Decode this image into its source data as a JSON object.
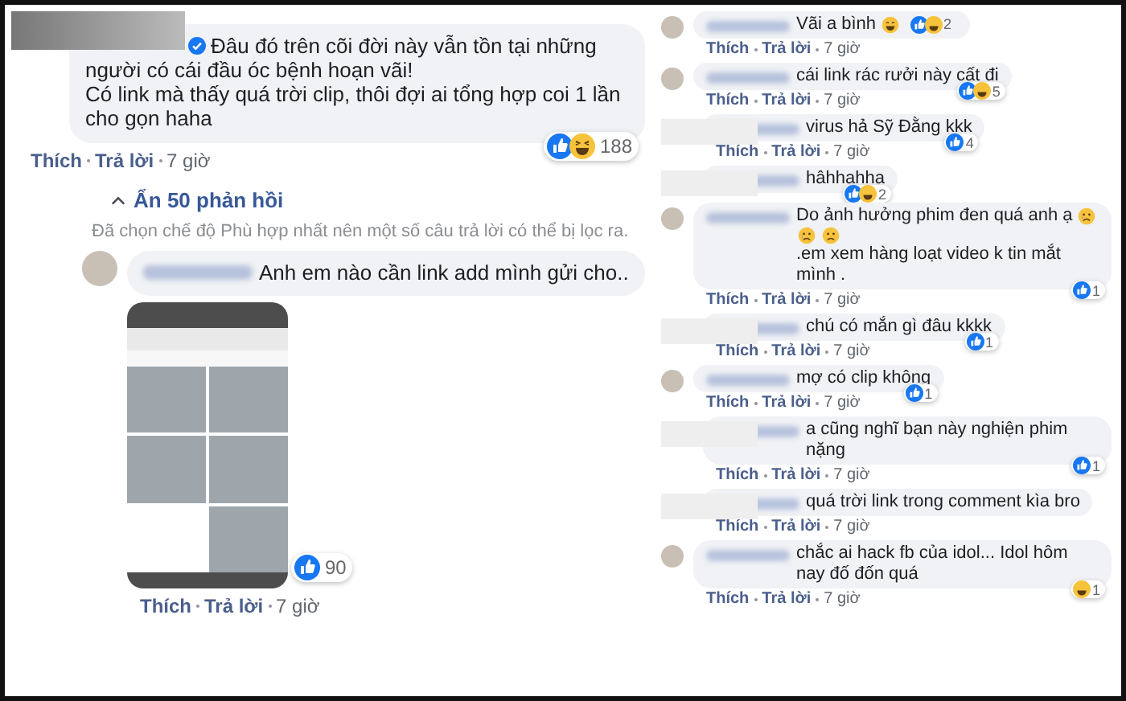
{
  "left": {
    "main_comment": {
      "verified": true,
      "text_lines": [
        "Đâu đó trên cõi đời này vẫn tồn tại những người có cái đầu óc bệnh hoạn vãi!",
        "Có link mà thấy quá trời clip, thôi đợi ai tổng hợp coi 1 lần cho gọn haha"
      ],
      "reactions": [
        {
          "kind": "like"
        },
        {
          "kind": "haha"
        }
      ],
      "reaction_count": "188",
      "actions": [
        "Thích",
        "Trả lời",
        "7 giờ"
      ]
    },
    "hide_replies": "Ẩn 50 phản hồi",
    "filter_notice": "Đã chọn chế độ Phù hợp nhất nên một số câu trả lời có thể bị lọc ra.",
    "reply": {
      "text": "Anh em nào cần link add mình gửi cho..",
      "reactions": [
        {
          "kind": "like"
        }
      ],
      "reaction_count": "90",
      "actions": [
        "Thích",
        "Trả lời",
        "7 giờ"
      ]
    }
  },
  "right": {
    "comments": [
      {
        "redacted": false,
        "segments": [
          {
            "kind": "text",
            "text": "Vãi a bình"
          },
          {
            "kind": "grin"
          }
        ],
        "reactions": [
          {
            "kind": "like"
          },
          {
            "kind": "haha"
          }
        ],
        "reaction_count": "2",
        "inline_reactions": true,
        "actions": [
          "Thích",
          "Trả lời",
          "7 giờ"
        ]
      },
      {
        "redacted": false,
        "segments": [
          {
            "kind": "text",
            "text": "cái link rác rưởi này cất đi"
          }
        ],
        "reactions": [
          {
            "kind": "like"
          },
          {
            "kind": "haha"
          }
        ],
        "reaction_count": "5",
        "inline_reactions": false,
        "actions": [
          "Thích",
          "Trả lời",
          "7 giờ"
        ]
      },
      {
        "redacted": true,
        "segments": [
          {
            "kind": "text",
            "text": "virus hả Sỹ Đằng kkk"
          }
        ],
        "reactions": [
          {
            "kind": "like"
          }
        ],
        "reaction_count": "4",
        "inline_reactions": false,
        "actions": [
          "Thích",
          "Trả lời",
          "7 giờ"
        ]
      },
      {
        "redacted": true,
        "segments": [
          {
            "kind": "text",
            "text": "hâhhahha"
          }
        ],
        "reactions": [
          {
            "kind": "like"
          },
          {
            "kind": "haha"
          }
        ],
        "reaction_count": "2",
        "inline_reactions": false
      },
      {
        "redacted": false,
        "segments": [
          {
            "kind": "text",
            "text": "Do ảnh hưởng phim đen quá anh ạ"
          },
          {
            "kind": "cry"
          },
          {
            "kind": "cry"
          },
          {
            "kind": "sad"
          },
          {
            "kind": "text",
            "text": ".em xem hàng loạt video k tin mắt mình ."
          }
        ],
        "reactions": [
          {
            "kind": "like"
          }
        ],
        "reaction_count": "1",
        "inline_reactions": false,
        "actions": [
          "Thích",
          "Trả lời",
          "7 giờ"
        ]
      },
      {
        "redacted": true,
        "segments": [
          {
            "kind": "text",
            "text": "chú có mắn gì đâu kkkk"
          }
        ],
        "reactions": [
          {
            "kind": "like"
          }
        ],
        "reaction_count": "1",
        "inline_reactions": false,
        "actions": [
          "Thích",
          "Trả lời",
          "7 giờ"
        ]
      },
      {
        "redacted": false,
        "segments": [
          {
            "kind": "text",
            "text": "mợ có clip không"
          }
        ],
        "reactions": [
          {
            "kind": "like"
          }
        ],
        "reaction_count": "1",
        "inline_reactions": false,
        "actions": [
          "Thích",
          "Trả lời",
          "7 giờ"
        ]
      },
      {
        "redacted": true,
        "segments": [
          {
            "kind": "text",
            "text": "a cũng nghĩ bạn này nghiện phim nặng"
          }
        ],
        "reactions": [
          {
            "kind": "like"
          }
        ],
        "reaction_count": "1",
        "inline_reactions": false,
        "actions": [
          "Thích",
          "Trả lời",
          "7 giờ"
        ]
      },
      {
        "redacted": true,
        "segments": [
          {
            "kind": "text",
            "text": "quá trời link trong comment kìa bro"
          }
        ],
        "actions": [
          "Thích",
          "Trả lời",
          "7 giờ"
        ]
      },
      {
        "redacted": false,
        "segments": [
          {
            "kind": "text",
            "text": "chắc ai hack fb của idol... Idol hôm nay đố đốn quá"
          }
        ],
        "reactions": [
          {
            "kind": "haha"
          }
        ],
        "reaction_count": "1",
        "inline_reactions": false,
        "actions": [
          "Thích",
          "Trả lời",
          "7 giờ"
        ]
      }
    ]
  }
}
